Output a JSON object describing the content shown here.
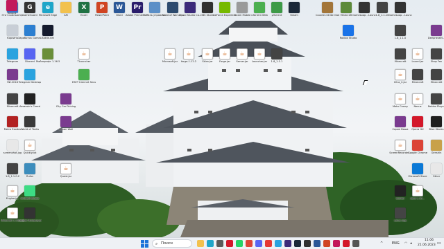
{
  "desktop_icons": [
    {
      "label": "Этот компьютер",
      "icon": "computer-icon",
      "color": "#3a7bd5",
      "glyph": ""
    },
    {
      "label": "GameGuard",
      "icon": "game-icon",
      "color": "#333333",
      "glyph": "G"
    },
    {
      "label": "Microsoft Edge",
      "icon": "edge-icon",
      "color": "#1fa6c9",
      "glyph": "e"
    },
    {
      "label": "AM",
      "icon": "folder-icon",
      "color": "#f2c14e",
      "glyph": ""
    },
    {
      "label": "Excel",
      "icon": "excel-icon",
      "color": "#1f7244",
      "glyph": "X"
    },
    {
      "label": "PowerPoint",
      "icon": "powerpoint-icon",
      "color": "#d04423",
      "glyph": "P"
    },
    {
      "label": "Word",
      "icon": "word-icon",
      "color": "#2b5797",
      "glyph": "W"
    },
    {
      "label": "Adobe Premiere Pr...",
      "icon": "premiere-icon",
      "color": "#2a1d6b",
      "glyph": "Pr"
    },
    {
      "label": "Панель управления",
      "icon": "control-panel-icon",
      "color": "#5b8fc7",
      "glyph": ""
    },
    {
      "label": "World of Warships",
      "icon": "warships-icon",
      "color": "#2c4a6e",
      "glyph": ""
    },
    {
      "label": "Visual Studio Co...",
      "icon": "vs-icon",
      "color": "#3b2a7a",
      "glyph": ""
    },
    {
      "label": "OBS Studio",
      "icon": "obs-icon",
      "color": "#303030",
      "glyph": ""
    },
    {
      "label": "GeForce Experience",
      "icon": "geforce-icon",
      "color": "#76b900",
      "glyph": ""
    },
    {
      "label": "Steam Mobile",
      "icon": "gamepad-icon",
      "color": "#9a9a9a",
      "glyph": ""
    },
    {
      "label": "uTorrent Web",
      "icon": "utorrent-icon",
      "color": "#4caf50",
      "glyph": ""
    },
    {
      "label": "µTorrent",
      "icon": "utorrent-icon",
      "color": "#3d9a47",
      "glyph": ""
    },
    {
      "label": "Steam",
      "icon": "steam-icon",
      "color": "#1b2838",
      "glyph": ""
    },
    {
      "label": "Counter-Strike Global...",
      "icon": "csgo-icon",
      "color": "#a3763a",
      "glyph": ""
    },
    {
      "label": "Minecraft",
      "icon": "minecraft-icon",
      "color": "#5d8a3a",
      "glyph": ""
    },
    {
      "label": "GameLoop - Launcher",
      "icon": "game-icon",
      "color": "#333333",
      "glyph": ""
    },
    {
      "label": "1.8_1.1.10",
      "icon": "minecraft-skin-icon",
      "color": "#444444",
      "glyph": ""
    },
    {
      "label": "GameLoop - Launcher",
      "icon": "game-icon",
      "color": "#333333",
      "glyph": ""
    },
    {
      "label": "Корзина",
      "icon": "recycle-bin-icon",
      "color": "#c8ced6",
      "glyph": ""
    },
    {
      "label": "Заработок GameLoop",
      "icon": "monitor-icon",
      "color": "#2c7fd1",
      "glyph": ""
    },
    {
      "label": "Battle.net",
      "icon": "battlenet-icon",
      "color": "#151b2e",
      "glyph": ""
    },
    {
      "label": "Roblox Studio",
      "icon": "roblox-icon",
      "color": "#1a73e8",
      "glyph": ""
    },
    {
      "label": "1.8_1.1.0",
      "icon": "minecraft-skin-icon",
      "color": "#444444",
      "glyph": ""
    },
    {
      "label": "DeepnessM...",
      "icon": "winrar-icon",
      "color": "#7a3b8f",
      "glyph": ""
    },
    {
      "label": "Telegram",
      "icon": "telegram-icon",
      "color": "#2aa3df",
      "glyph": ""
    },
    {
      "label": "Discord",
      "icon": "discord-icon",
      "color": "#5865f2",
      "glyph": ""
    },
    {
      "label": "Майнкрафт 1.16.5",
      "icon": "minecraft-icon",
      "color": "#6a8f3a",
      "glyph": ""
    },
    {
      "label": "TLauncher",
      "icon": "java-icon",
      "color": "#ffffff",
      "glyph": "☕"
    },
    {
      "label": "Microsoft.jar",
      "icon": "java-icon",
      "color": "#ffffff",
      "glyph": "☕"
    },
    {
      "label": "forge-1.12.2",
      "icon": "java-icon",
      "color": "#ffffff",
      "glyph": "☕"
    },
    {
      "label": "Skins.jar",
      "icon": "java-icon",
      "color": "#ffffff",
      "glyph": "☕"
    },
    {
      "label": "Forge.jar",
      "icon": "java-icon",
      "color": "#ffffff",
      "glyph": "☕"
    },
    {
      "label": "Server.jar",
      "icon": "java-icon",
      "color": "#ffffff",
      "glyph": "☕"
    },
    {
      "label": "Launcher.jar",
      "icon": "java-icon",
      "color": "#ffffff",
      "glyph": "☕"
    },
    {
      "label": "1.8_1.1.1",
      "icon": "minecraft-skin-icon",
      "color": "#444444",
      "glyph": ""
    },
    {
      "label": "Minecraft",
      "icon": "minecraft-skin-icon",
      "color": "#444444",
      "glyph": ""
    },
    {
      "label": "Laurel.jar",
      "icon": "java-icon",
      "color": "#ffffff",
      "glyph": "☕"
    },
    {
      "label": "Shop Fan",
      "icon": "minecraft-skin-icon",
      "color": "#444444",
      "glyph": ""
    },
    {
      "label": "ПИ-2018",
      "icon": "winrar-icon",
      "color": "#7a3b8f",
      "glyph": ""
    },
    {
      "label": "Telegram Desktop",
      "icon": "telegram-icon",
      "color": "#2aa3df",
      "glyph": ""
    },
    {
      "label": "ESET Internet Security",
      "icon": "eset-icon",
      "color": "#4caf50",
      "glyph": ""
    },
    {
      "label": "Citra_2.jar",
      "icon": "java-icon",
      "color": "#ffffff",
      "glyph": "☕"
    },
    {
      "label": "Minecraft",
      "icon": "minecraft-skin-icon",
      "color": "#444444",
      "glyph": ""
    },
    {
      "label": "Minecraft",
      "icon": "minecraft-skin-icon",
      "color": "#444444",
      "glyph": ""
    },
    {
      "label": "Minecraft",
      "icon": "minecraft-skin-icon",
      "color": "#444444",
      "glyph": ""
    },
    {
      "label": "Assassin's Creed",
      "icon": "assassins-creed-icon",
      "color": "#222222",
      "glyph": ""
    },
    {
      "label": "City Car Driving",
      "icon": "winrar-icon",
      "color": "#7a3b8f",
      "glyph": ""
    },
    {
      "label": "Moto Crossy",
      "icon": "java-icon",
      "color": "#ffffff",
      "glyph": "☕"
    },
    {
      "label": "Nexus",
      "icon": "java-icon",
      "color": "#ffffff",
      "glyph": "☕"
    },
    {
      "label": "Roblox Player",
      "icon": "minecraft-skin-icon",
      "color": "#444444",
      "glyph": ""
    },
    {
      "label": "Metro Exodus",
      "icon": "metro-icon",
      "color": "#b22222",
      "glyph": ""
    },
    {
      "label": "World of Tanks",
      "icon": "wot-icon",
      "color": "#3a3a3a",
      "glyph": ""
    },
    {
      "label": "Скрин Wall",
      "icon": "winrar-icon",
      "color": "#7a3b8f",
      "glyph": ""
    },
    {
      "label": "Скрин Ваша",
      "icon": "winrar-icon",
      "color": "#7a3b8f",
      "glyph": ""
    },
    {
      "label": "Opera GX",
      "icon": "opera-icon",
      "color": "#d3182a",
      "glyph": ""
    },
    {
      "label": "Blue Stacks",
      "icon": "bluestacks-icon",
      "color": "#1f1f1f",
      "glyph": ""
    },
    {
      "label": "screenshot.jpg",
      "icon": "image-file-icon",
      "color": "#e8e8e8",
      "glyph": ""
    },
    {
      "label": "Quickly.txt",
      "icon": "java-icon",
      "color": "#ffffff",
      "glyph": "☕"
    },
    {
      "label": "ScreenRecorder...",
      "icon": "java-icon",
      "color": "#ffffff",
      "glyph": "☕"
    },
    {
      "label": "Google Chrome",
      "icon": "chrome-icon",
      "color": "#db4437",
      "glyph": ""
    },
    {
      "label": "Genshin",
      "icon": "genshin-icon",
      "color": "#c8a14a",
      "glyph": ""
    },
    {
      "label": "1.8_1.1.0.2",
      "icon": "minecraft-skin-icon",
      "color": "#444444",
      "glyph": ""
    },
    {
      "label": "Rufus",
      "icon": "rufus-icon",
      "color": "#3c8dbc",
      "glyph": ""
    },
    {
      "label": "Quest.jar",
      "icon": "java-icon",
      "color": "#ffffff",
      "glyph": "☕"
    },
    {
      "label": "Microsoft Store",
      "icon": "store-icon",
      "color": "#0a79d6",
      "glyph": ""
    },
    {
      "label": "Other",
      "icon": "file-icon",
      "color": "#e8e8e8",
      "glyph": ""
    },
    {
      "label": "Engine.jar",
      "icon": "java-icon",
      "color": "#ffffff",
      "glyph": "☕"
    },
    {
      "label": "Android Studio",
      "icon": "android-icon",
      "color": "#3ddc84",
      "glyph": ""
    },
    {
      "label": "Stalker",
      "icon": "stalker-icon",
      "color": "#222222",
      "glyph": ""
    },
    {
      "label": "Java 1.10...",
      "icon": "java-icon",
      "color": "#ffffff",
      "glyph": "☕"
    },
    {
      "label": "Minecraft 1.10.2.jar",
      "icon": "java-icon",
      "color": "#ffffff",
      "glyph": "☕"
    },
    {
      "label": "Outlast Multiplayer",
      "icon": "outlast-icon",
      "color": "#333333",
      "glyph": ""
    },
    {
      "label": "Lotus App",
      "icon": "lotus-icon",
      "color": "#444444",
      "glyph": ""
    },
    {
      "label": "Record",
      "icon": "record-icon",
      "color": "#c2185b",
      "glyph": ""
    }
  ],
  "taskbar": {
    "search_placeholder": "Поиск",
    "apps": [
      {
        "icon": "explorer-icon",
        "color": "#f2c14e"
      },
      {
        "icon": "edge-icon",
        "color": "#1fa6c9"
      },
      {
        "icon": "gamepad-icon",
        "color": "#5a5a5a"
      },
      {
        "icon": "opera-icon",
        "color": "#d3182a"
      },
      {
        "icon": "whatsapp-icon",
        "color": "#25d366"
      },
      {
        "icon": "chrome-icon",
        "color": "#db4437"
      },
      {
        "icon": "discord-icon",
        "color": "#5865f2"
      },
      {
        "icon": "yandex-icon",
        "color": "#e53935"
      },
      {
        "icon": "telegram-icon",
        "color": "#2aa3df"
      },
      {
        "icon": "vs-icon",
        "color": "#3b2a7a"
      },
      {
        "icon": "steam-icon",
        "color": "#1b2838"
      },
      {
        "icon": "obs-icon",
        "color": "#303030"
      },
      {
        "icon": "word-icon",
        "color": "#2b5797"
      },
      {
        "icon": "powerpoint-icon",
        "color": "#d04423"
      },
      {
        "icon": "record-icon",
        "color": "#c2185b"
      },
      {
        "icon": "opera-icon",
        "color": "#d3182a"
      },
      {
        "icon": "game-icon",
        "color": "#555555"
      }
    ],
    "lang": "ENG",
    "time": "11:06",
    "date": "21.06.2023"
  }
}
